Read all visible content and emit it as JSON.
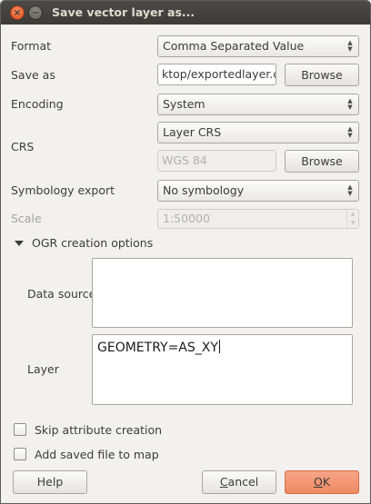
{
  "window": {
    "title": "Save vector layer as...",
    "close_glyph": "×",
    "minimize_glyph": "−"
  },
  "form": {
    "format_label": "Format",
    "format_value": "Comma Separated Value",
    "save_as_label": "Save as",
    "save_as_value": "ktop/exportedlayer.csv",
    "browse_label": "Browse",
    "encoding_label": "Encoding",
    "encoding_value": "System",
    "crs_label": "CRS",
    "crs_value": "Layer CRS",
    "crs_display": "WGS 84",
    "crs_browse_label": "Browse",
    "symbology_label": "Symbology export",
    "symbology_value": "No symbology",
    "scale_label": "Scale",
    "scale_value": "1:50000"
  },
  "ogr": {
    "section_label": "OGR creation options",
    "datasource_label": "Data source",
    "datasource_value": "",
    "layer_label": "Layer",
    "layer_value": "GEOMETRY=AS_XY"
  },
  "options": {
    "skip_attr_label": "Skip attribute creation",
    "skip_attr_checked": false,
    "add_map_label": "Add saved file to map",
    "add_map_checked": false
  },
  "buttons": {
    "help": "Help",
    "cancel_mnemonic": "C",
    "cancel_rest": "ancel",
    "ok_mnemonic": "O",
    "ok_rest": "K"
  },
  "colors": {
    "accent_ok": "#ef8a62",
    "titlebar": "#3c3b37",
    "close_button": "#e0521d"
  },
  "icons": {
    "close": "close-icon",
    "minimize": "minimize-icon",
    "combo_arrows": "up-down-arrows-icon",
    "expand": "triangle-down-icon"
  }
}
